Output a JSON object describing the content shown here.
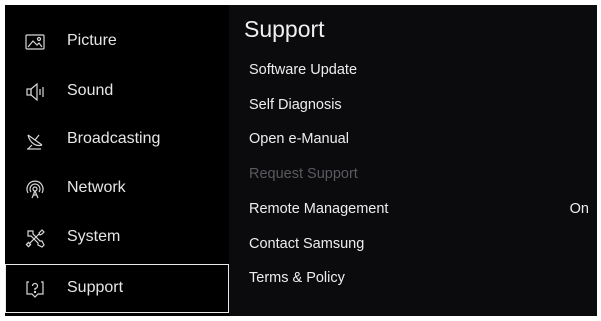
{
  "sidebar": {
    "items": [
      {
        "label": "Picture",
        "icon": "picture-icon",
        "selected": false
      },
      {
        "label": "Sound",
        "icon": "speaker-icon",
        "selected": false
      },
      {
        "label": "Broadcasting",
        "icon": "satellite-dish-icon",
        "selected": false
      },
      {
        "label": "Network",
        "icon": "network-icon",
        "selected": false
      },
      {
        "label": "System",
        "icon": "tools-icon",
        "selected": false
      },
      {
        "label": "Support",
        "icon": "question-bubble-icon",
        "selected": true
      }
    ]
  },
  "panel": {
    "title": "Support",
    "items": [
      {
        "label": "Software Update",
        "value": "",
        "enabled": true
      },
      {
        "label": "Self Diagnosis",
        "value": "",
        "enabled": true
      },
      {
        "label": "Open e-Manual",
        "value": "",
        "enabled": true
      },
      {
        "label": "Request Support",
        "value": "",
        "enabled": false
      },
      {
        "label": "Remote Management",
        "value": "On",
        "enabled": true
      },
      {
        "label": "Contact Samsung",
        "value": "",
        "enabled": true
      },
      {
        "label": "Terms & Policy",
        "value": "",
        "enabled": true
      }
    ]
  },
  "colors": {
    "background": "#000000",
    "panel_background": "#0b0b0e",
    "text": "#e6e6e6",
    "disabled_text": "#5a5a5e",
    "selection_outline": "#e8e8e8"
  }
}
